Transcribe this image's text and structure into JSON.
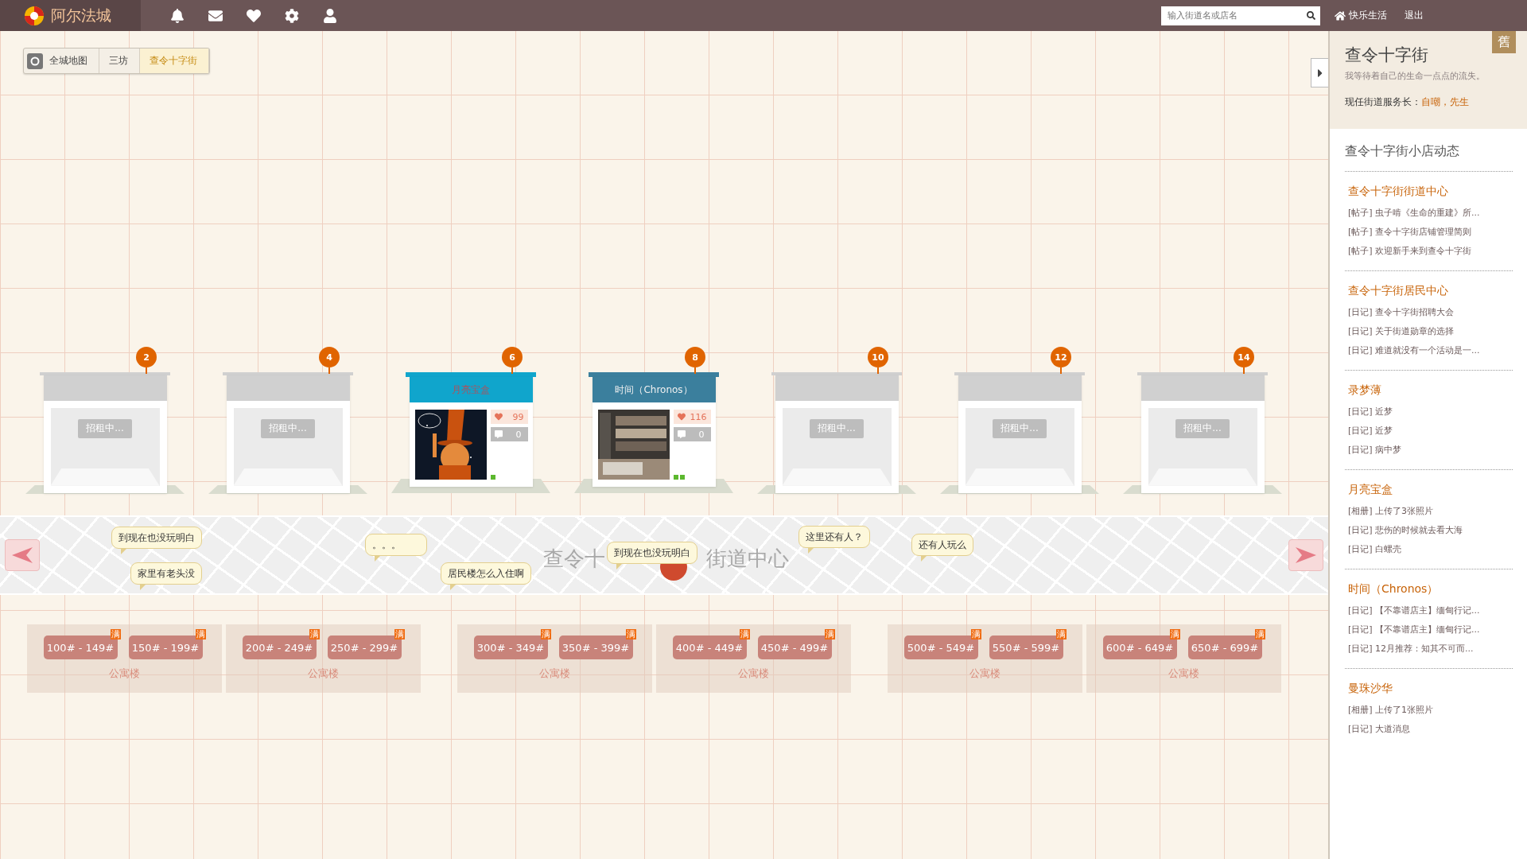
{
  "topbar": {
    "logo_text": "阿尔法城",
    "search": {
      "placeholder": "输入街道名或店名"
    },
    "home_link": "快乐生活",
    "logout": "退出"
  },
  "breadcrumb": [
    {
      "label": "全城地图",
      "selected": false
    },
    {
      "label": "三坊",
      "selected": false
    },
    {
      "label": "查令十字街",
      "selected": true
    }
  ],
  "shops": [
    {
      "kind": "vacant",
      "number": "2",
      "sign": "招租中..."
    },
    {
      "kind": "vacant",
      "number": "4",
      "sign": "招租中..."
    },
    {
      "kind": "open",
      "number": "6",
      "name": "月亮宝盒",
      "color": "#10a5cc",
      "likes": "99",
      "comments": "0"
    },
    {
      "kind": "open",
      "number": "8",
      "name": "时间（Chronos）",
      "color": "#3b7f9d",
      "likes": "116",
      "comments": "0"
    },
    {
      "kind": "vacant",
      "number": "10",
      "sign": "招租中..."
    },
    {
      "kind": "vacant",
      "number": "12",
      "sign": "招租中..."
    },
    {
      "kind": "vacant",
      "number": "14",
      "sign": "招租中..."
    }
  ],
  "street": {
    "label_left": "查令十",
    "label_right": "街道中心",
    "bubbles": [
      {
        "text": "到现在也没玩明白"
      },
      {
        "text": "家里有老头没"
      },
      {
        "text": "。。。"
      },
      {
        "text": "居民楼怎么入住啊"
      },
      {
        "text": "到现在也没玩明白"
      },
      {
        "text": "这里还有人？"
      },
      {
        "text": "还有人玩么"
      }
    ]
  },
  "apartments": [
    {
      "label": "公寓楼",
      "rooms": [
        {
          "range": "100# - 149#",
          "badge": "满"
        },
        {
          "range": "150# - 199#",
          "badge": "满"
        }
      ]
    },
    {
      "label": "公寓楼",
      "rooms": [
        {
          "range": "200# - 249#",
          "badge": "满"
        },
        {
          "range": "250# - 299#",
          "badge": "满"
        }
      ]
    },
    {
      "label": "公寓楼",
      "rooms": [
        {
          "range": "300# - 349#",
          "badge": "满"
        },
        {
          "range": "350# - 399#",
          "badge": "满"
        }
      ]
    },
    {
      "label": "公寓楼",
      "rooms": [
        {
          "range": "400# - 449#",
          "badge": "满"
        },
        {
          "range": "450# - 499#",
          "badge": "满"
        }
      ]
    },
    {
      "label": "公寓楼",
      "rooms": [
        {
          "range": "500# - 549#",
          "badge": "满"
        },
        {
          "range": "550# - 599#",
          "badge": "满"
        }
      ]
    },
    {
      "label": "公寓楼",
      "rooms": [
        {
          "range": "600# - 649#",
          "badge": "满"
        },
        {
          "range": "650# - 699#",
          "badge": "满"
        }
      ]
    }
  ],
  "sidebar": {
    "badge": "舊",
    "title": "查令十字街",
    "motto": "我等待着自己的生命一点点的流失。",
    "manager_label": "现任街道服务长：",
    "manager_name": "自嘲，先生",
    "feed_title": "查令十字街小店动态",
    "groups": [
      {
        "title": "查令十字街街道中心",
        "items": [
          "[帖子] 虫子啃《生命的重建》所...",
          "[帖子] 查令十字街店铺管理简则",
          "[帖子] 欢迎新手来到查令十字街"
        ]
      },
      {
        "title": "查令十字街居民中心",
        "items": [
          "[日记] 查令十字街招聘大会",
          "[日记] 关于街道勋章的选择",
          "[日记] 难道就没有一个活动是一..."
        ]
      },
      {
        "title": "录梦薄",
        "items": [
          "[日记] 近梦",
          "[日记] 近梦",
          "[日记] 病中梦"
        ]
      },
      {
        "title": "月亮宝盒",
        "items": [
          "[相册] 上传了3张照片",
          "[日记] 悲伤的时候就去看大海",
          "[日记] 白螺壳"
        ]
      },
      {
        "title": "时间（Chronos）",
        "items": [
          "[日记] 【不靠谱店主】缅甸行记...",
          "[日记] 【不靠谱店主】缅甸行记...",
          "[日记] 12月推荐：知其不可而..."
        ]
      },
      {
        "title": "曼珠沙华",
        "items": [
          "[相册] 上传了1张照片",
          "[日记] 大道消息"
        ]
      }
    ]
  }
}
